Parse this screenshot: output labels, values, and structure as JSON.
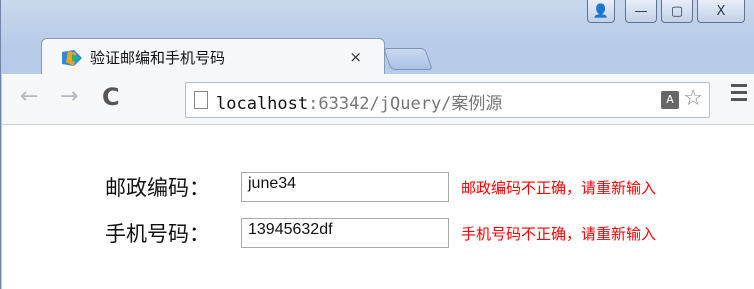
{
  "window": {
    "controls": {
      "user": "👤",
      "minimize": "—",
      "maximize": "▢",
      "close": "X"
    }
  },
  "tab": {
    "title": "验证邮编和手机号码",
    "close": "×"
  },
  "toolbar": {
    "back": "←",
    "forward": "→",
    "reload": "C",
    "url_host": "localhost",
    "url_rest": ":63342/jQuery/案例源",
    "translate": "A",
    "star": "☆"
  },
  "form": {
    "postcode_label": "邮政编码：",
    "postcode_value": "june34",
    "postcode_error": "邮政编码不正确，请重新输入",
    "phone_label": "手机号码：",
    "phone_value": "13945632df",
    "phone_error": "手机号码不正确，请重新输入",
    "error_color": "#ff0000"
  }
}
